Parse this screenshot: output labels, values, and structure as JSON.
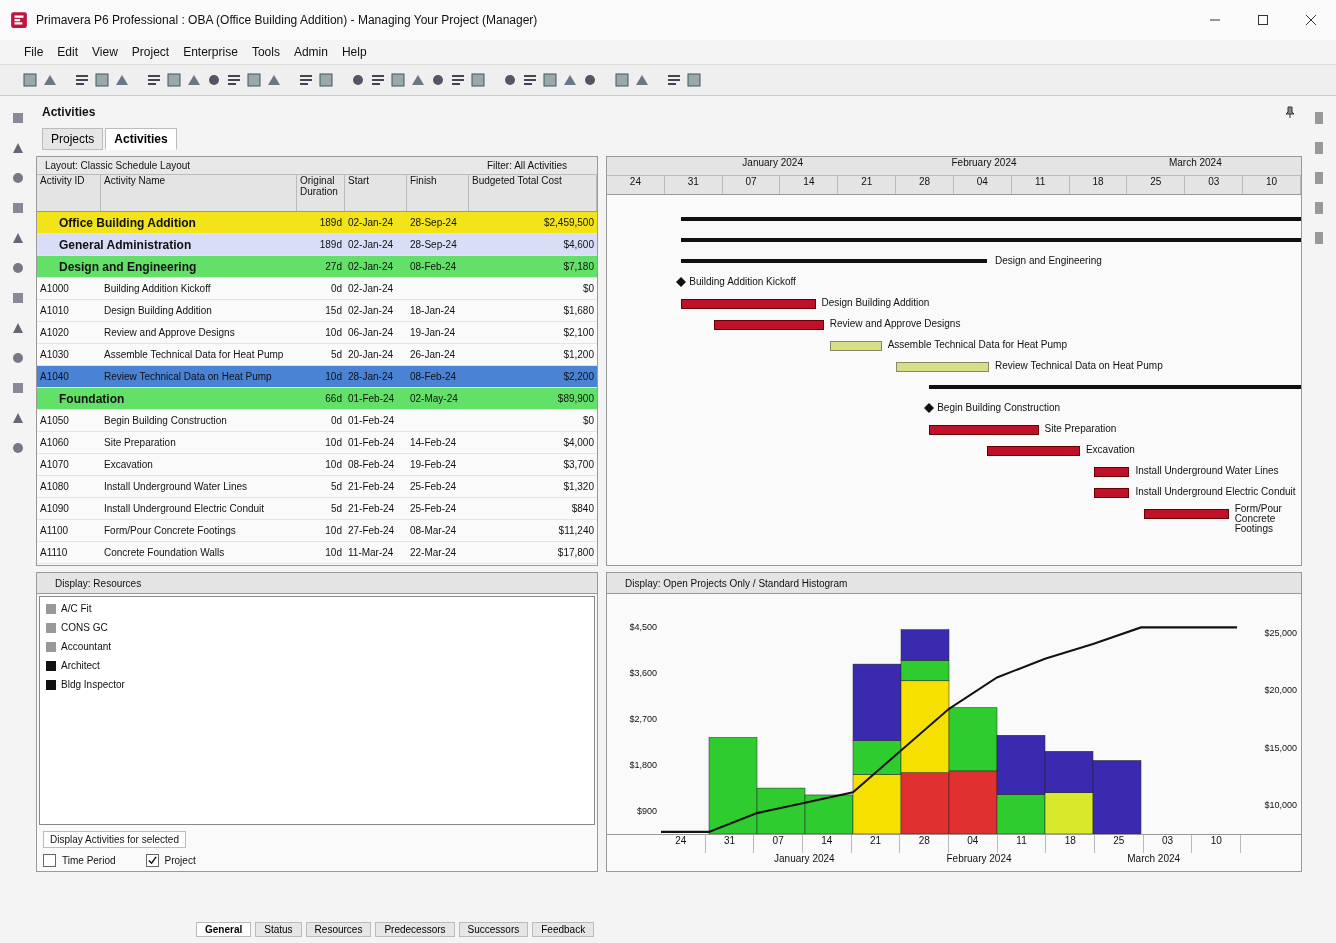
{
  "window": {
    "title": "Primavera P6 Professional : OBA (Office Building Addition) - Managing Your Project (Manager)"
  },
  "menu": [
    "File",
    "Edit",
    "View",
    "Project",
    "Enterprise",
    "Tools",
    "Admin",
    "Help"
  ],
  "workspace": {
    "title": "Activities"
  },
  "tabs": [
    {
      "label": "Projects",
      "selected": false
    },
    {
      "label": "Activities",
      "selected": true
    }
  ],
  "layout_bar": {
    "layout": "Layout: Classic Schedule Layout",
    "filter": "Filter: All Activities"
  },
  "table": {
    "columns": [
      "Activity ID",
      "Activity Name",
      "Original Duration",
      "Start",
      "Finish",
      "Budgeted Total Cost"
    ],
    "rows": [
      {
        "kind": "wbs",
        "name": "Office Building Addition",
        "duration": "189d",
        "start": "02-Jan-24",
        "finish": "28-Sep-24",
        "cost": "$2,459,500",
        "color": "#f2e418",
        "selected": false
      },
      {
        "kind": "wbs",
        "name": "General Administration",
        "duration": "189d",
        "start": "02-Jan-24",
        "finish": "28-Sep-24",
        "cost": "$4,600",
        "color": "#d9ddf6",
        "selected": false
      },
      {
        "kind": "wbs",
        "name": "Design and Engineering",
        "duration": "27d",
        "start": "02-Jan-24",
        "finish": "08-Feb-24",
        "cost": "$7,180",
        "color": "#62e068",
        "selected": false,
        "bar_label": "Design and Engineering"
      },
      {
        "kind": "milestone",
        "id": "A1000",
        "name": "Building Addition Kickoff",
        "duration": "0d",
        "start": "02-Jan-24",
        "cost": "$0",
        "selected": false,
        "bar_label": "Building Addition Kickoff"
      },
      {
        "kind": "activity",
        "id": "A1010",
        "name": "Design Building Addition",
        "duration": "15d",
        "start": "02-Jan-24",
        "finish": "18-Jan-24",
        "cost": "$1,680",
        "selected": false,
        "critical": true,
        "bar_label": "Design Building Addition"
      },
      {
        "kind": "activity",
        "id": "A1020",
        "name": "Review and Approve Designs",
        "duration": "10d",
        "start": "06-Jan-24",
        "finish": "19-Jan-24",
        "cost": "$2,100",
        "selected": false,
        "critical": true,
        "bar_label": "Review and Approve Designs"
      },
      {
        "kind": "activity",
        "id": "A1030",
        "name": "Assemble Technical Data for Heat Pump",
        "duration": "5d",
        "start": "20-Jan-24",
        "finish": "26-Jan-24",
        "cost": "$1,200",
        "selected": false,
        "critical": false,
        "bar_label": "Assemble Technical Data for Heat Pump"
      },
      {
        "kind": "activity",
        "id": "A1040",
        "name": "Review Technical Data on Heat Pump",
        "duration": "10d",
        "start": "28-Jan-24",
        "finish": "08-Feb-24",
        "cost": "$2,200",
        "selected": true,
        "critical": false,
        "bar_label": "Review Technical Data on Heat Pump"
      },
      {
        "kind": "wbs",
        "name": "Foundation",
        "duration": "66d",
        "start": "01-Feb-24",
        "finish": "02-May-24",
        "cost": "$89,900",
        "color": "#62e068",
        "selected": false
      },
      {
        "kind": "milestone",
        "id": "A1050",
        "name": "Begin Building Construction",
        "duration": "0d",
        "start": "01-Feb-24",
        "cost": "$0",
        "selected": false,
        "bar_label": "Begin Building Construction"
      },
      {
        "kind": "activity",
        "id": "A1060",
        "name": "Site Preparation",
        "duration": "10d",
        "start": "01-Feb-24",
        "finish": "14-Feb-24",
        "cost": "$4,000",
        "selected": false,
        "critical": true,
        "bar_label": "Site Preparation"
      },
      {
        "kind": "activity",
        "id": "A1070",
        "name": "Excavation",
        "duration": "10d",
        "start": "08-Feb-24",
        "finish": "19-Feb-24",
        "cost": "$3,700",
        "selected": false,
        "critical": true,
        "bar_label": "Excavation"
      },
      {
        "kind": "activity",
        "id": "A1080",
        "name": "Install Underground Water Lines",
        "duration": "5d",
        "start": "21-Feb-24",
        "finish": "25-Feb-24",
        "cost": "$1,320",
        "selected": false,
        "critical": true,
        "bar_label": "Install Underground Water Lines"
      },
      {
        "kind": "activity",
        "id": "A1090",
        "name": "Install Underground Electric Conduit",
        "duration": "5d",
        "start": "21-Feb-24",
        "finish": "25-Feb-24",
        "cost": "$840",
        "selected": false,
        "critical": true,
        "bar_label": "Install Underground Electric Conduit"
      },
      {
        "kind": "activity",
        "id": "A1100",
        "name": "Form/Pour Concrete Footings",
        "duration": "10d",
        "start": "27-Feb-24",
        "finish": "08-Mar-24",
        "cost": "$11,240",
        "selected": false,
        "critical": true,
        "bar_label": "Form/Pour Concrete Footings"
      },
      {
        "kind": "activity",
        "id": "A1110",
        "name": "Concrete Foundation Walls",
        "duration": "10d",
        "start": "11-Mar-24",
        "finish": "22-Mar-24",
        "cost": "$17,800",
        "selected": false
      }
    ]
  },
  "timescale": {
    "months": [
      "January 2024",
      "February 2024",
      "March 2024"
    ],
    "weeks": [
      "24",
      "31",
      "07",
      "14",
      "21",
      "28",
      "04",
      "11",
      "18",
      "25",
      "03",
      "10"
    ]
  },
  "resources": {
    "header": "Display: Resources",
    "items": [
      "A/C Fit",
      "CONS GC",
      "Accountant",
      "Architect",
      "Bldg Inspector"
    ],
    "footer": "Display Activities for selected",
    "options": [
      {
        "label": "Time Period",
        "checked": false
      },
      {
        "label": "Project",
        "checked": true
      }
    ]
  },
  "histogram": {
    "header": "Display: Open Projects Only / Standard Histogram",
    "left_ticks": [
      "$4,500",
      "$3,600",
      "$2,700",
      "$1,800",
      "$900"
    ],
    "right_ticks": [
      "$25,000",
      "$20,000",
      "$15,000",
      "$10,000"
    ],
    "weeks": [
      "24",
      "31",
      "07",
      "14",
      "21",
      "28",
      "04",
      "11",
      "18",
      "25",
      "03",
      "10"
    ],
    "months": [
      "January 2024",
      "February 2024",
      "March 2024"
    ]
  },
  "bottom_tabs": [
    {
      "label": "General",
      "selected": true
    },
    {
      "label": "Status",
      "selected": false
    },
    {
      "label": "Resources",
      "selected": false
    },
    {
      "label": "Predecessors",
      "selected": false
    },
    {
      "label": "Successors",
      "selected": false
    },
    {
      "label": "Feedback",
      "selected": false
    }
  ]
}
